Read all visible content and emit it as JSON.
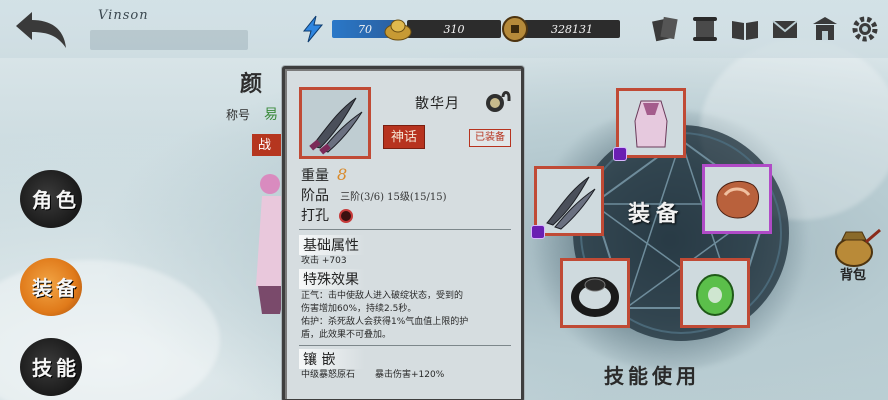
{
  "player": {
    "name": "Vinson"
  },
  "resources": {
    "energy": "70",
    "gold": "310",
    "coins": "328131"
  },
  "side_menu": [
    {
      "label": "角色",
      "active": false
    },
    {
      "label": "装备",
      "active": true
    },
    {
      "label": "技能",
      "active": false
    }
  ],
  "character": {
    "name": "颜",
    "title_label": "称号",
    "title_value": "易",
    "tag": "战"
  },
  "item": {
    "name": "散华月",
    "grade": "神话",
    "status": "已装备",
    "weight_label": "重量",
    "weight_value": "8",
    "rank_label": "阶品",
    "rank_value": "三阶(3/6) 15级(15/15)",
    "socket_label": "打孔",
    "base_title": "基础属性",
    "base_attr": "攻击 +703",
    "special_title": "特殊效果",
    "special_line1_prefix": "正气：击中使敌人进入破绽状态，受到的",
    "special_line1_mid": "伤害增加60%，持续2.5秒。",
    "special_line2": "佑护：杀死敌人会获得1%气血值上限的护",
    "special_line3": "盾，此效果不可叠加。",
    "inlay_title": "镶 嵌",
    "inlay_gem": "中级暴怒原石",
    "inlay_bonus": "暴击伤害+120%"
  },
  "equipment": {
    "center_label": "装备"
  },
  "buttons": {
    "skill_use": "技能使用",
    "bag": "背包"
  },
  "colors": {
    "frame_red": "#c04a35",
    "frame_purple": "#b04bc7",
    "mythic_red": "#b7331f",
    "weight_orange": "#d8892a"
  },
  "icons": [
    "back-arrow-icon",
    "energy-bolt-icon",
    "gold-ingot-icon",
    "coin-icon",
    "cards-icon",
    "scroll-icon",
    "book-icon",
    "mail-icon",
    "shop-icon",
    "gear-icon",
    "lock-icon"
  ]
}
